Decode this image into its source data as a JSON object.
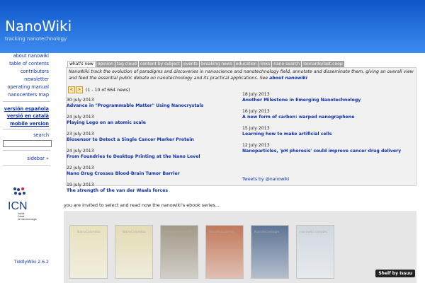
{
  "header": {
    "title": "NanoWiki",
    "subtitle": "tracking nanotechnology"
  },
  "sidebar": {
    "links": [
      "about nanowiki",
      "table of contents",
      "contributors",
      "newsletter",
      "operating manual",
      "nanocenters map"
    ],
    "languages": [
      "versión española",
      "versió en català",
      "mobile version"
    ],
    "search_label": "search",
    "toggle_label": "sidebar »",
    "logo_text": "ICN",
    "logo_subtext": "Institut Català de Nanotecnologia",
    "version": "TiddlyWiki 2.6.2"
  },
  "tabs": [
    "what's new",
    "opinion",
    "tag cloud",
    "content by subject",
    "events",
    "breaking news",
    "education",
    "links",
    "nano search",
    "leonardo/last.coop"
  ],
  "intro": {
    "text": "NanoWiki track the evolution of paradigms and discoveries in nanoscience and nanotechnology field, annotate and disseminate them, giving an overall view and feed the essential public debate on nanotechnology and its practical applications. See ",
    "link": "about nanowiki"
  },
  "pager": {
    "prev": "<",
    "next": ">",
    "info": "(1 - 10 of 664 news)"
  },
  "news_left": [
    {
      "date": "30 July 2013",
      "title": "Advance in \"Programmable Matter\" Using Nanocrystals"
    },
    {
      "date": "24 July 2013",
      "title": "Playing Lego on an atomic scale"
    },
    {
      "date": "23 July 2013",
      "title": "Biosensor to Detect a Single Cancer Marker Protein"
    },
    {
      "date": "24 July 2013",
      "title": "From Foundries to Desktop Printing at the Nano Level"
    },
    {
      "date": "22 July 2013",
      "title": "Nano Drug Crosses Blood-Brain Tumor Barrier"
    },
    {
      "date": "19 July 2013",
      "title": "The strength of the van der Waals forces"
    }
  ],
  "news_right": [
    {
      "date": "18 July 2013",
      "title": "Another Milestone in Emerging Nanotechnology"
    },
    {
      "date": "16 July 2013",
      "title": "A new form of carbon: warped nanographene"
    },
    {
      "date": "15 July 2013",
      "title": "Learning how to make artificial cells"
    },
    {
      "date": "12 July 2013",
      "title": "Nanoparticles, 'pH phoresis' could improve cancer drug delivery"
    }
  ],
  "tweets_link": "Tweets by @nanowiki",
  "ebook_note": "you are invited to select and read now the nanowiki's ebook series...",
  "shelf": {
    "books": [
      {
        "label": "NanoColombia",
        "color": "#e9e0b0"
      },
      {
        "label": "NanoColombia",
        "color": "#e3d9a5"
      },
      {
        "label": "Nanomedicina file",
        "color": "#8b8069"
      },
      {
        "label": "NanoFuturamas",
        "color": "#b6552c"
      },
      {
        "label": "Nanotecnologie",
        "color": "#30507a"
      },
      {
        "label": "nanowiki nanotec",
        "color": "#c9d3dd"
      }
    ],
    "button_label": "Shelf by Issuu"
  }
}
